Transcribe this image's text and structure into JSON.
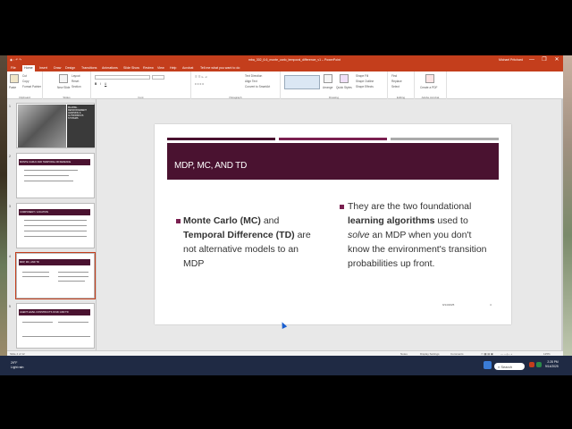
{
  "window": {
    "title": "mba_302_6.6_monte_carlo_temporal_difference_v1 – PowerPoint",
    "user": "Michael Pritchard",
    "minimize_icon": "—",
    "restore_icon": "❐",
    "close_icon": "✕"
  },
  "menu": {
    "tabs": [
      "File",
      "Home",
      "Insert",
      "Draw",
      "Design",
      "Transitions",
      "Animations",
      "Slide Show",
      "Review",
      "View",
      "Help",
      "Acrobat"
    ],
    "tell_me": "Tell me what you want to do"
  },
  "ribbon": {
    "groups": [
      "Clipboard",
      "Slides",
      "Font",
      "Paragraph",
      "Drawing",
      "Editing",
      "Adobe Acrobat"
    ],
    "clipboard": {
      "paste": "Paste",
      "cut": "Cut",
      "copy": "Copy",
      "format_painter": "Format Painter"
    },
    "slides": {
      "new_slide": "New Slide",
      "layout": "Layout",
      "reset": "Reset",
      "section": "Section"
    },
    "paragraph": {
      "text_direction": "Text Direction",
      "align_text": "Align Text",
      "convert": "Convert to SmartArt"
    },
    "drawing": {
      "arrange": "Arrange",
      "quick_styles": "Quick Styles",
      "shape_fill": "Shape Fill",
      "shape_outline": "Shape Outline",
      "shape_effects": "Shape Effects"
    },
    "editing": {
      "find": "Find",
      "replace": "Replace",
      "select": "Select"
    },
    "acrobat": {
      "create_pdf": "Create a PDF"
    }
  },
  "thumbnails": [
    {
      "num": "1",
      "title": "MLADSE - REINFORCEMENT LEARNING & AUTONOMOUS SYSTEMS"
    },
    {
      "num": "2",
      "title": "MONTE CARLO AND TEMPORAL DIFFERENCE"
    },
    {
      "num": "3",
      "title": "COMPONENT / LOCATION"
    },
    {
      "num": "4",
      "title": "MDP, MC, AND TD"
    },
    {
      "num": "5",
      "title": "AGENT LEVEL CONSTRUCTS IN MC AND TD"
    }
  ],
  "slide": {
    "title": "MDP, MC, AND TD",
    "left_bullet": {
      "b1": "Monte Carlo (MC)",
      "t1": " and ",
      "b2": "Temporal Difference (TD)",
      "t2": " are not alternative models to an MDP"
    },
    "right_bullet": {
      "t1": "They are the two foundational ",
      "b1": "learning algorithms",
      "t2": " used to ",
      "i1": "solve",
      "t3": " an MDP when you don't know the environment's transition probabilities up front."
    },
    "footer_date": "9/14/2025",
    "page_number": "4"
  },
  "status": {
    "slide_of": "Slide 4 of 12",
    "notes": "Notes",
    "display_settings": "Display Settings",
    "comments": "Comments",
    "zoom": "125%"
  },
  "taskbar": {
    "weather_temp": "29°F",
    "weather_desc": "Light rain",
    "search_placeholder": "Search",
    "time": "2:28 PM",
    "date": "9/14/2025"
  },
  "colors": {
    "accent": "#c43e1c",
    "slide_title_band": "#4a1230",
    "bullet": "#7a2050"
  }
}
